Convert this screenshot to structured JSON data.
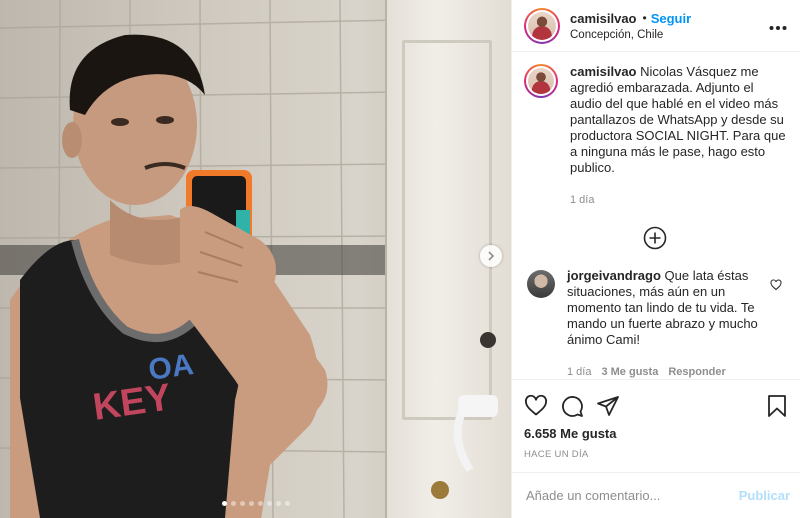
{
  "header": {
    "username": "camisilvao",
    "separator": "•",
    "follow_label": "Seguir",
    "location": "Concepción, Chile",
    "more_icon": "more-horizontal-icon"
  },
  "caption": {
    "username": "camisilvao",
    "text": " Nicolas Vásquez me agredió embarazada. Adjunto el audio del que hablé en el video más pantallazos de WhatsApp y desde su productora SOCIAL NIGHT. Para que a ninguna más le pase, hago esto publico.",
    "time": "1 día"
  },
  "load_more_icon": "plus-circle-icon",
  "comments": [
    {
      "username": "jorgeivandrago",
      "text": " Que lata éstas situaciones, más aún en un momento tan lindo de tu vida. Te mando un fuerte abrazo y mucho ánimo Cami!",
      "time": "1 día",
      "likes": "3 Me gusta",
      "reply": "Responder"
    }
  ],
  "actions": {
    "likes": "6.658 Me gusta",
    "posted_ago": "HACE UN DÍA"
  },
  "add_comment": {
    "placeholder": "Añade un comentario...",
    "publish_label": "Publicar"
  },
  "carousel": {
    "slide_count": 8,
    "active_index": 0
  },
  "colors": {
    "accent": "#0095f6",
    "publish_disabled": "#b2dffc",
    "muted": "#8e8e8e"
  }
}
